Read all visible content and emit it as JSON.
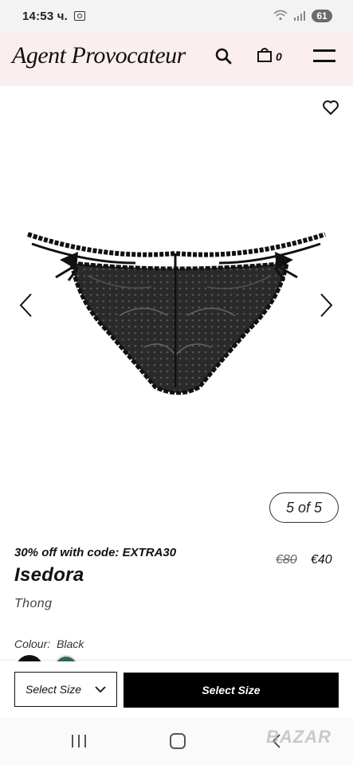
{
  "status_bar": {
    "time": "14:53 ч.",
    "battery": "61",
    "wifi_icon": "wifi-icon",
    "signal_icon": "signal-icon"
  },
  "header": {
    "logo_text": "Agent Provocateur",
    "bag_count": "0",
    "icons": [
      "search-icon",
      "bag-icon",
      "menu-icon"
    ]
  },
  "gallery": {
    "counter": "5 of 5",
    "icons": [
      "heart-icon",
      "chevron-left-icon",
      "chevron-right-icon"
    ]
  },
  "product": {
    "promo": "30% off with code: EXTRA30",
    "name": "Isedora",
    "type": "Thong",
    "price_old": "€80",
    "price_new": "€40",
    "colour_label": "Colour:",
    "colour_value": "Black",
    "swatches": [
      "#111111",
      "#2f6a55"
    ]
  },
  "action_bar": {
    "size_select_label": "Select Size",
    "button_label": "Select Size"
  },
  "watermark": "BAZAR",
  "colors": {
    "header_bg": "#fbeeee",
    "button_bg": "#000000"
  }
}
